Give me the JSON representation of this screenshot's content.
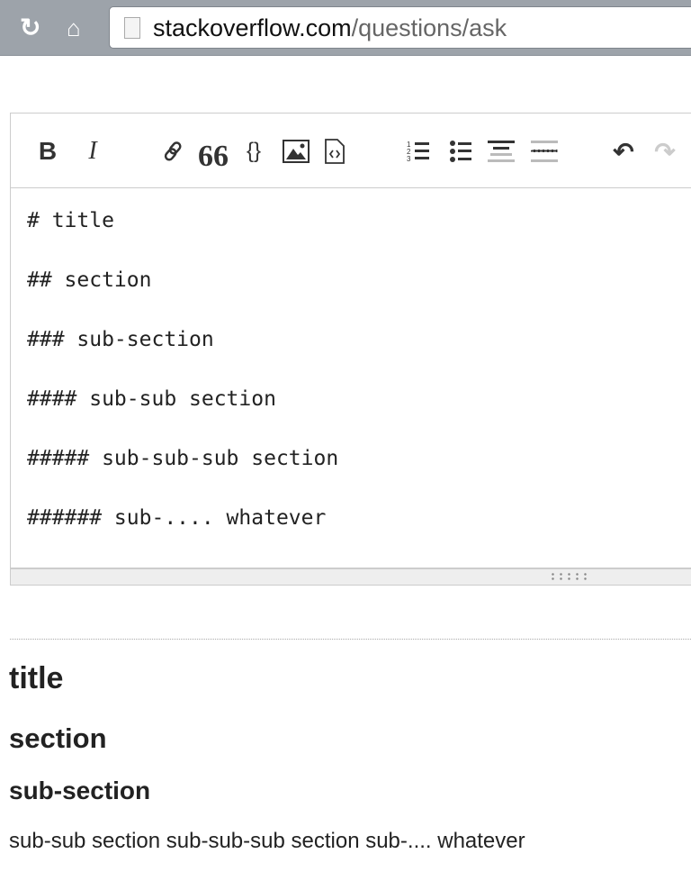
{
  "browser": {
    "url_host": "stackoverflow.com",
    "url_path": "/questions/ask",
    "icons": [
      "reload-icon",
      "home-icon",
      "page-icon"
    ]
  },
  "toolbar": {
    "buttons": [
      "bold",
      "italic",
      "link",
      "blockquote",
      "code",
      "image",
      "snippet",
      "ordered-list",
      "bulleted-list",
      "heading",
      "horizontal-rule",
      "undo",
      "redo"
    ],
    "bold": "B",
    "italic": "I",
    "quote": "66",
    "code": "{}"
  },
  "editor": {
    "lines": [
      "# title",
      "",
      "## section",
      "",
      "### sub-section",
      "",
      "#### sub-sub section",
      "",
      "##### sub-sub-sub section",
      "",
      "###### sub-.... whatever"
    ]
  },
  "preview": {
    "h1": "title",
    "h2": "section",
    "h3": "sub-section",
    "paragraph": "sub-sub section sub-sub-sub section sub-.... whatever"
  }
}
